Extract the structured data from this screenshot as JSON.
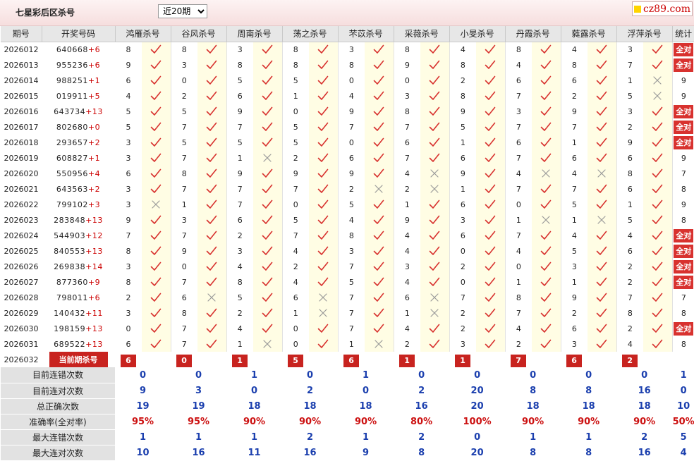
{
  "header": {
    "title": "七星彩后区杀号",
    "period_select": {
      "selected": "近20期",
      "options": [
        "近20期"
      ]
    },
    "site_badge": "cz89.com"
  },
  "columns": [
    "期号",
    "开奖号码",
    "鸿雁杀号",
    "谷风杀号",
    "周南杀号",
    "荡之杀号",
    "芣苡杀号",
    "采薇杀号",
    "小旻杀号",
    "丹霞杀号",
    "蕤露杀号",
    "浮萍杀号",
    "统计"
  ],
  "draws": [
    {
      "issue": "2026012",
      "numbers": "640668",
      "back": "+6",
      "kills": [
        "8",
        "8",
        "3",
        "8",
        "3",
        "8",
        "4",
        "8",
        "4",
        "3"
      ],
      "results": [
        1,
        1,
        1,
        1,
        1,
        1,
        1,
        1,
        1,
        1
      ],
      "stat": "全对"
    },
    {
      "issue": "2026013",
      "numbers": "955236",
      "back": "+6",
      "kills": [
        "9",
        "3",
        "8",
        "8",
        "8",
        "9",
        "8",
        "4",
        "8",
        "7"
      ],
      "results": [
        1,
        1,
        1,
        1,
        1,
        1,
        1,
        1,
        1,
        1
      ],
      "stat": "全对"
    },
    {
      "issue": "2026014",
      "numbers": "988251",
      "back": "+1",
      "kills": [
        "6",
        "0",
        "5",
        "5",
        "0",
        "0",
        "2",
        "6",
        "6",
        "1"
      ],
      "results": [
        1,
        1,
        1,
        1,
        1,
        1,
        1,
        1,
        1,
        0
      ],
      "stat": "9"
    },
    {
      "issue": "2026015",
      "numbers": "019911",
      "back": "+5",
      "kills": [
        "4",
        "2",
        "6",
        "1",
        "4",
        "3",
        "8",
        "7",
        "2",
        "5"
      ],
      "results": [
        1,
        1,
        1,
        1,
        1,
        1,
        1,
        1,
        1,
        0
      ],
      "stat": "9"
    },
    {
      "issue": "2026016",
      "numbers": "643734",
      "back": "+13",
      "kills": [
        "5",
        "5",
        "9",
        "0",
        "9",
        "8",
        "9",
        "3",
        "9",
        "3"
      ],
      "results": [
        1,
        1,
        1,
        1,
        1,
        1,
        1,
        1,
        1,
        1
      ],
      "stat": "全对"
    },
    {
      "issue": "2026017",
      "numbers": "802680",
      "back": "+0",
      "kills": [
        "5",
        "7",
        "7",
        "5",
        "7",
        "7",
        "5",
        "7",
        "7",
        "2"
      ],
      "results": [
        1,
        1,
        1,
        1,
        1,
        1,
        1,
        1,
        1,
        1
      ],
      "stat": "全对"
    },
    {
      "issue": "2026018",
      "numbers": "293657",
      "back": "+2",
      "kills": [
        "3",
        "5",
        "5",
        "5",
        "0",
        "6",
        "1",
        "6",
        "1",
        "9"
      ],
      "results": [
        1,
        1,
        1,
        1,
        1,
        1,
        1,
        1,
        1,
        1
      ],
      "stat": "全对"
    },
    {
      "issue": "2026019",
      "numbers": "608827",
      "back": "+1",
      "kills": [
        "3",
        "7",
        "1",
        "2",
        "6",
        "7",
        "6",
        "7",
        "6",
        "6"
      ],
      "results": [
        1,
        1,
        0,
        1,
        1,
        1,
        1,
        1,
        1,
        1
      ],
      "stat": "9"
    },
    {
      "issue": "2026020",
      "numbers": "550956",
      "back": "+4",
      "kills": [
        "6",
        "8",
        "9",
        "9",
        "9",
        "4",
        "9",
        "4",
        "4",
        "8"
      ],
      "results": [
        1,
        1,
        1,
        1,
        1,
        0,
        1,
        0,
        0,
        1
      ],
      "stat": "7"
    },
    {
      "issue": "2026021",
      "numbers": "643563",
      "back": "+2",
      "kills": [
        "3",
        "7",
        "7",
        "7",
        "2",
        "2",
        "1",
        "7",
        "7",
        "6"
      ],
      "results": [
        1,
        1,
        1,
        1,
        0,
        0,
        1,
        1,
        1,
        1
      ],
      "stat": "8"
    },
    {
      "issue": "2026022",
      "numbers": "799102",
      "back": "+3",
      "kills": [
        "3",
        "1",
        "7",
        "0",
        "5",
        "1",
        "6",
        "0",
        "5",
        "1"
      ],
      "results": [
        0,
        1,
        1,
        1,
        1,
        1,
        1,
        1,
        1,
        1
      ],
      "stat": "9"
    },
    {
      "issue": "2026023",
      "numbers": "283848",
      "back": "+13",
      "kills": [
        "9",
        "3",
        "6",
        "5",
        "4",
        "9",
        "3",
        "1",
        "1",
        "5"
      ],
      "results": [
        1,
        1,
        1,
        1,
        1,
        1,
        1,
        0,
        0,
        1
      ],
      "stat": "8"
    },
    {
      "issue": "2026024",
      "numbers": "544903",
      "back": "+12",
      "kills": [
        "7",
        "7",
        "2",
        "7",
        "8",
        "4",
        "6",
        "7",
        "4",
        "4"
      ],
      "results": [
        1,
        1,
        1,
        1,
        1,
        1,
        1,
        1,
        1,
        1
      ],
      "stat": "全对"
    },
    {
      "issue": "2026025",
      "numbers": "840553",
      "back": "+13",
      "kills": [
        "8",
        "9",
        "3",
        "4",
        "3",
        "4",
        "0",
        "4",
        "5",
        "6"
      ],
      "results": [
        1,
        1,
        1,
        1,
        1,
        1,
        1,
        1,
        1,
        1
      ],
      "stat": "全对"
    },
    {
      "issue": "2026026",
      "numbers": "269838",
      "back": "+14",
      "kills": [
        "3",
        "0",
        "4",
        "2",
        "7",
        "3",
        "2",
        "0",
        "3",
        "2"
      ],
      "results": [
        1,
        1,
        1,
        1,
        1,
        1,
        1,
        1,
        1,
        1
      ],
      "stat": "全对"
    },
    {
      "issue": "2026027",
      "numbers": "877360",
      "back": "+9",
      "kills": [
        "8",
        "7",
        "8",
        "4",
        "5",
        "4",
        "0",
        "1",
        "1",
        "2"
      ],
      "results": [
        1,
        1,
        1,
        1,
        1,
        1,
        1,
        1,
        1,
        1
      ],
      "stat": "全对"
    },
    {
      "issue": "2026028",
      "numbers": "798011",
      "back": "+6",
      "kills": [
        "2",
        "6",
        "5",
        "6",
        "7",
        "6",
        "7",
        "8",
        "9",
        "7"
      ],
      "results": [
        1,
        0,
        1,
        0,
        1,
        0,
        1,
        1,
        1,
        1
      ],
      "stat": "7"
    },
    {
      "issue": "2026029",
      "numbers": "140432",
      "back": "+11",
      "kills": [
        "3",
        "8",
        "2",
        "1",
        "7",
        "1",
        "2",
        "7",
        "2",
        "8"
      ],
      "results": [
        1,
        1,
        1,
        0,
        1,
        0,
        1,
        1,
        1,
        1
      ],
      "stat": "8"
    },
    {
      "issue": "2026030",
      "numbers": "198159",
      "back": "+13",
      "kills": [
        "0",
        "7",
        "4",
        "0",
        "7",
        "4",
        "2",
        "4",
        "6",
        "2"
      ],
      "results": [
        1,
        1,
        1,
        1,
        1,
        1,
        1,
        1,
        1,
        1
      ],
      "stat": "全对"
    },
    {
      "issue": "2026031",
      "numbers": "689522",
      "back": "+13",
      "kills": [
        "6",
        "7",
        "1",
        "0",
        "1",
        "2",
        "3",
        "2",
        "3",
        "4"
      ],
      "results": [
        1,
        1,
        0,
        1,
        0,
        1,
        1,
        1,
        1,
        1
      ],
      "stat": "8"
    }
  ],
  "current": {
    "issue": "2026032",
    "label": "当前期杀号",
    "kills": [
      "6",
      "0",
      "1",
      "5",
      "6",
      "1",
      "1",
      "7",
      "6",
      "2"
    ]
  },
  "summary": [
    {
      "label": "目前连错次数",
      "values": [
        "0",
        "0",
        "1",
        "0",
        "1",
        "0",
        "0",
        "0",
        "0",
        "0"
      ],
      "stat": "1",
      "rate": false
    },
    {
      "label": "目前连对次数",
      "values": [
        "9",
        "3",
        "0",
        "2",
        "0",
        "2",
        "20",
        "8",
        "8",
        "16"
      ],
      "stat": "0",
      "rate": false
    },
    {
      "label": "总正确次数",
      "values": [
        "19",
        "19",
        "18",
        "18",
        "18",
        "16",
        "20",
        "18",
        "18",
        "18"
      ],
      "stat": "10",
      "rate": false
    },
    {
      "label": "准确率(全对率)",
      "values": [
        "95%",
        "95%",
        "90%",
        "90%",
        "90%",
        "80%",
        "100%",
        "90%",
        "90%",
        "90%"
      ],
      "stat": "50%",
      "rate": true
    },
    {
      "label": "最大连错次数",
      "values": [
        "1",
        "1",
        "1",
        "2",
        "1",
        "2",
        "0",
        "1",
        "1",
        "2"
      ],
      "stat": "5",
      "rate": false
    },
    {
      "label": "最大连对次数",
      "values": [
        "10",
        "16",
        "11",
        "16",
        "9",
        "8",
        "20",
        "8",
        "8",
        "16"
      ],
      "stat": "4",
      "rate": false
    }
  ],
  "colors": {
    "accent_red": "#d8322f",
    "check_red": "#d8322f",
    "cross_gray": "#9a9a9a",
    "summary_blue": "#1b3fae",
    "mark_bg": "#fffde4"
  },
  "icons": {
    "hit": "check-icon",
    "miss": "cross-icon"
  }
}
